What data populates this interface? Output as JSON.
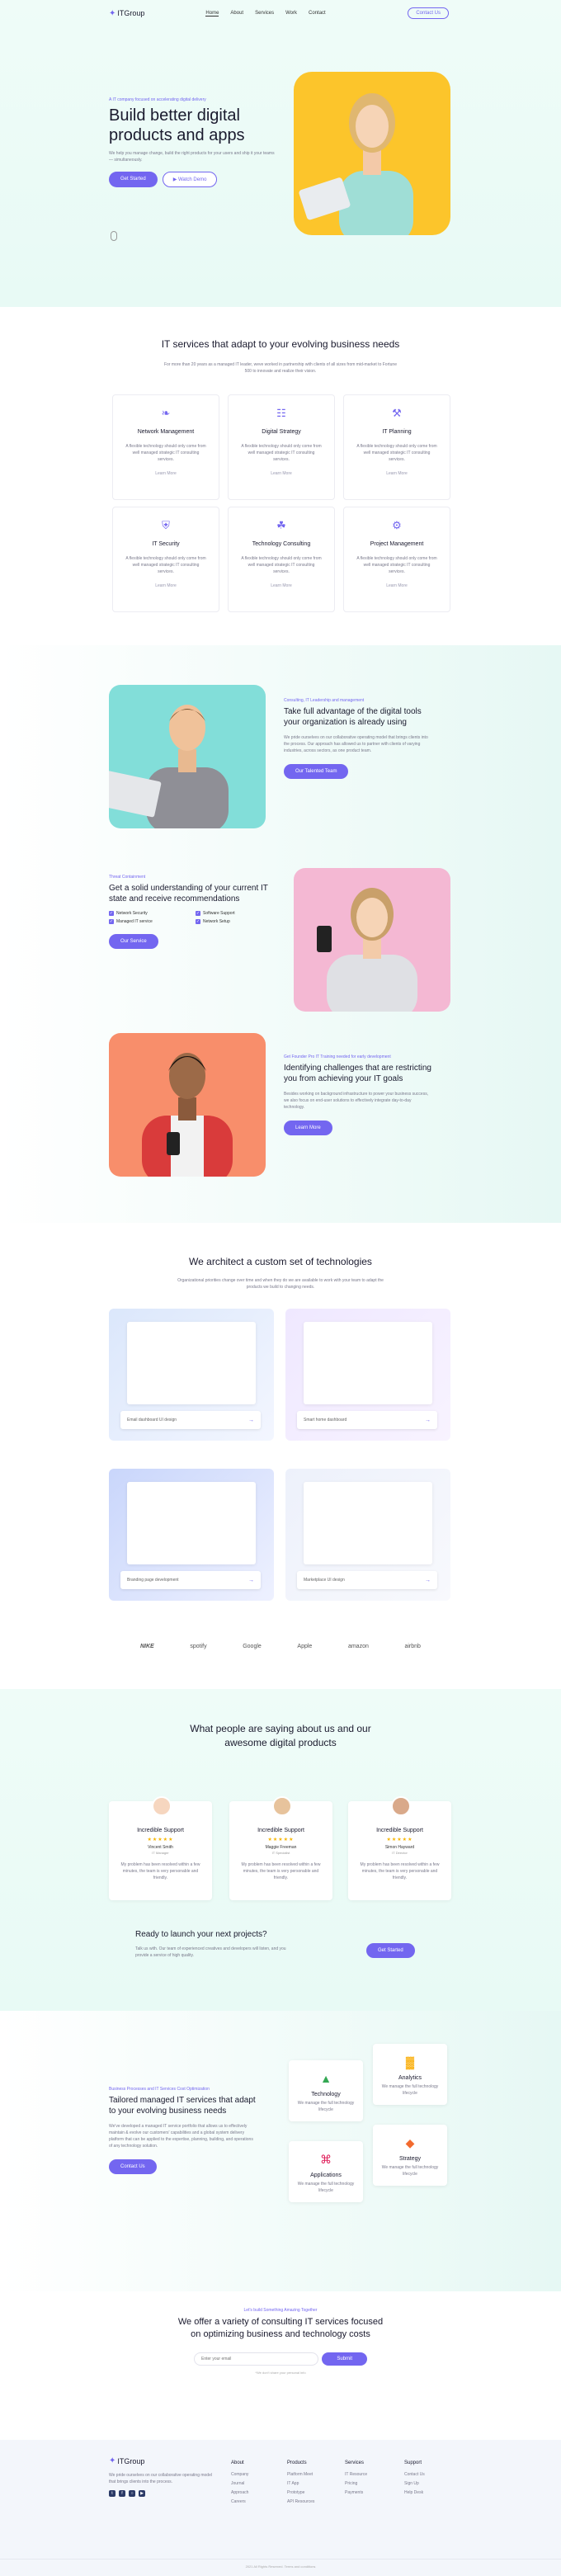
{
  "nav": {
    "brand": "ITGroup",
    "items": [
      "Home",
      "About",
      "Services",
      "Work",
      "Contact"
    ],
    "contact_button": "Contact Us"
  },
  "hero": {
    "eyebrow": "A IT company focused on accelerating digital delivery",
    "title": "Build better digital products and apps",
    "subtitle": "We help you manage change, build the right products for your users and ship it your teams — simultaneously.",
    "primary_button": "Get Started",
    "secondary_button": "Watch Demo"
  },
  "services": {
    "title": "IT services that adapt to your evolving business needs",
    "subtitle": "For more than 20 years as a managed IT leader, weve worked in partnership with clients of all sizes from mid-market to Fortune 500 to innovate and realize their vision.",
    "items": [
      {
        "icon": "leaf-icon",
        "glyph": "❧",
        "title": "Network Management",
        "desc": "A flexible technology should only come from well managed strategic IT consulting services.",
        "link": "Learn More"
      },
      {
        "icon": "strategy-icon",
        "glyph": "☷",
        "title": "Digital Strategy",
        "desc": "A flexible technology should only come from well managed strategic IT consulting services.",
        "link": "Learn More"
      },
      {
        "icon": "planning-icon",
        "glyph": "⚒",
        "title": "IT Planning",
        "desc": "A flexible technology should only come from well managed strategic IT consulting services.",
        "link": "Learn More"
      },
      {
        "icon": "shield-icon",
        "glyph": "⛨",
        "title": "IT Security",
        "desc": "A flexible technology should only come from well managed strategic IT consulting services.",
        "link": "Learn More"
      },
      {
        "icon": "network-icon",
        "glyph": "☘",
        "title": "Technology Consulting",
        "desc": "A flexible technology should only come from well managed strategic IT consulting services.",
        "link": "Learn More"
      },
      {
        "icon": "project-icon",
        "glyph": "⚙",
        "title": "Project Management",
        "desc": "A flexible technology should only come from well managed strategic IT consulting services.",
        "link": "Learn More"
      }
    ]
  },
  "features": {
    "f1": {
      "tag": "Consulting, IT Leadership and management",
      "title": "Take full advantage of the digital tools your organization is already using",
      "desc": "We pride ourselves on our collaborative operating model that brings clients into the process. Our approach has allowed us to partner with clients of varying industries, across sectors, as one product team.",
      "button": "Our Talented Team"
    },
    "f2": {
      "tag": "Threat Containment",
      "title": "Get a solid understanding of your current IT state and receive recommendations",
      "checks": [
        "Network Security",
        "Software Support",
        "Managed IT service",
        "Network Setup"
      ],
      "button": "Our Service"
    },
    "f3": {
      "tag": "Get Founder Pro IT Training needed for early development",
      "title": "Identifying challenges that are restricting you from achieving your IT goals",
      "desc": "Besides working on background infrastructure to power your business success, we also focus on end-user solutions to effectively integrate day-to-day technology.",
      "button": "Learn More"
    }
  },
  "tech": {
    "title": "We architect a custom set of technologies",
    "subtitle": "Organizational priorities change over time and when they do we are available to work with your team to adapt the products we build to changing needs.",
    "shots": [
      {
        "caption": "Email dashboard UI design"
      },
      {
        "caption": "Smart home dashboard"
      },
      {
        "caption": "Branding page development"
      },
      {
        "caption": "Marketplace UI design"
      }
    ],
    "logos": [
      "NIKE",
      "spotify",
      "Google",
      "Apple",
      "amazon",
      "airbnb"
    ]
  },
  "testimonials": {
    "title": "What people are saying about us and our awesome digital products",
    "cards": [
      {
        "title": "Incredible Support",
        "stars": "★★★★★",
        "name": "Vincent Smith",
        "role": "IT Manager",
        "quote": "My problem has been resolved within a few minutes, the team is very personable and friendly."
      },
      {
        "title": "Incredible Support",
        "stars": "★★★★★",
        "name": "Maggie Freeman",
        "role": "IT Specialist",
        "quote": "My problem has been resolved within a few minutes, the team is very personable and friendly."
      },
      {
        "title": "Incredible Support",
        "stars": "★★★★★",
        "name": "Simon Hayward",
        "role": "IT Director",
        "quote": "My problem has been resolved within a few minutes, the team is very personable and friendly."
      }
    ],
    "cta": {
      "title": "Ready to launch your next projects?",
      "desc": "Talk us with. Our team of experienced creatives and developers will listen, and you provide a service of high quality.",
      "button": "Get Started"
    }
  },
  "optimization": {
    "tag": "Business Processes and IT Services Cost Optimization",
    "title": "Tailored managed IT services that adapt to your evolving business needs",
    "desc": "We've developed a managed IT service portfolio that allows us to effectively maintain & evolve our customers' capabilities and a global system delivery platform that can be applied to the expertise, planning, building, and operations of any technology solution.",
    "button": "Contact Us",
    "cards": [
      {
        "icon": "drive-icon",
        "glyph": "▲",
        "color": "#34a853",
        "title": "Technology",
        "desc": "We manage the full technology lifecycle"
      },
      {
        "icon": "analytics-icon",
        "glyph": "▓",
        "color": "#f9ab00",
        "title": "Analytics",
        "desc": "We manage the full technology lifecycle"
      },
      {
        "icon": "slack-icon",
        "glyph": "⌘",
        "color": "#e01e5a",
        "title": "Applications",
        "desc": "We manage the full technology lifecycle"
      },
      {
        "icon": "strategy-icon",
        "glyph": "◆",
        "color": "#f26a2e",
        "title": "Strategy",
        "desc": "We manage the full technology lifecycle"
      }
    ]
  },
  "newsletter": {
    "tag": "Let's build Something Amazing Together",
    "title": "We offer a variety of consulting IT services focused on optimizing business and technology costs",
    "placeholder": "Enter your email",
    "button": "Submit",
    "note": "*We don't share your personal info"
  },
  "footer": {
    "brand": "ITGroup",
    "desc": "We pride ourselves on our collaborative operating model that brings clients into the process.",
    "columns": [
      {
        "heading": "About",
        "links": [
          "Company",
          "Journal",
          "Approach",
          "Careers"
        ]
      },
      {
        "heading": "Products",
        "links": [
          "Platform Meet",
          "IT App",
          "Prototype",
          "API Resources"
        ]
      },
      {
        "heading": "Services",
        "links": [
          "IT Resource",
          "Pricing",
          "Payments"
        ]
      },
      {
        "heading": "Support",
        "links": [
          "Contact Us",
          "Sign Up",
          "Help Desk"
        ]
      }
    ],
    "copyright": "2021 All Rights Reserved. Terms and conditions"
  },
  "colors": {
    "accent": "#7366f0",
    "hero_card": "#fcc52b",
    "mint": "#e8faf5",
    "teal_card": "#82ded9",
    "pink_card": "#f4b8d3",
    "coral_card": "#f88e6b",
    "star": "#f7b500"
  }
}
